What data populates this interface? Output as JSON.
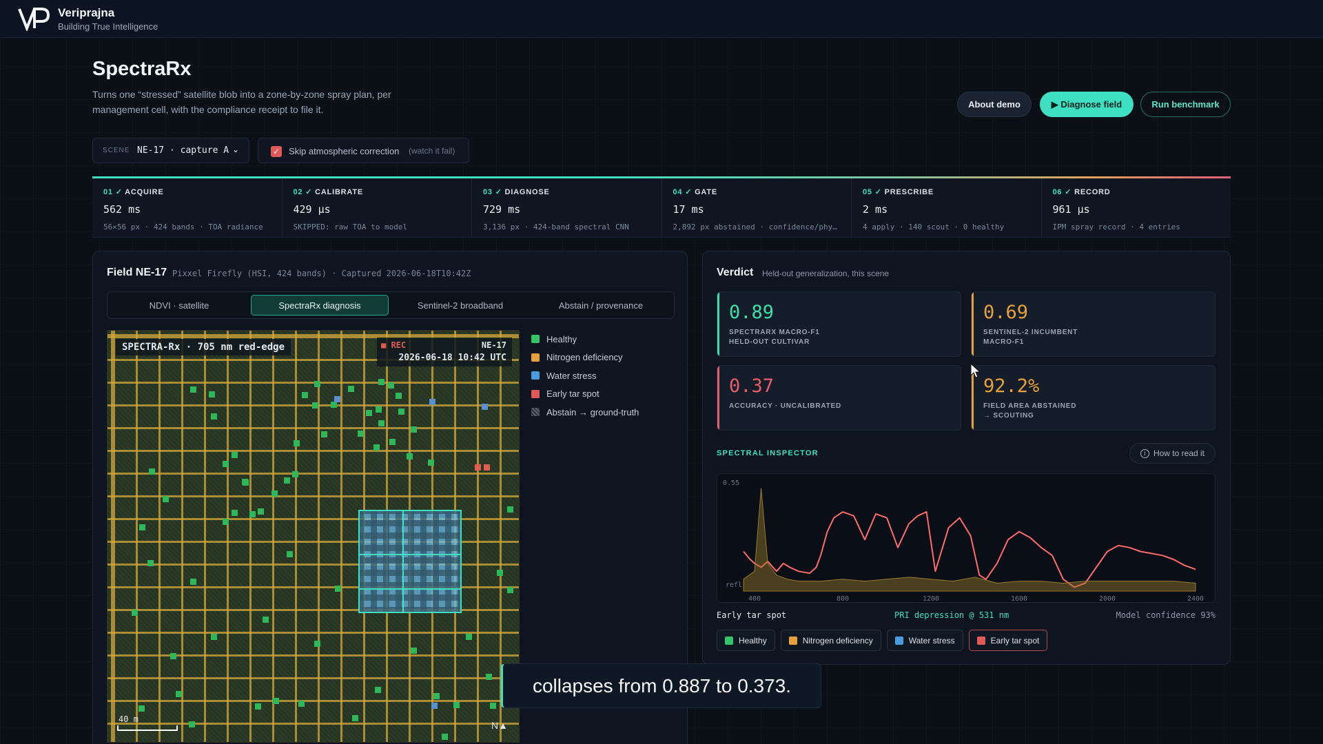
{
  "brand": {
    "name": "Veriprajna",
    "tagline": "Building True Intelligence"
  },
  "page": {
    "title": "SpectraRx",
    "subtitle": "Turns one “stressed” satellite blob into a zone-by-zone spray plan, per management cell, with the compliance receipt to file it."
  },
  "actions": {
    "about": "About demo",
    "diagnose": "▶ Diagnose field",
    "benchmark": "Run benchmark"
  },
  "scene": {
    "label": "SCENE",
    "value": "NE-17 · capture A",
    "chevron": "⌄"
  },
  "skip": {
    "label": "Skip atmospheric correction",
    "hint": "(watch it fail)",
    "checked": true
  },
  "pipeline": [
    {
      "num": "01",
      "name": "ACQUIRE",
      "value": "562 ms",
      "detail": "56×56 px · 424 bands · TOA radiance"
    },
    {
      "num": "02",
      "name": "CALIBRATE",
      "value": "429 µs",
      "detail": "SKIPPED: raw TOA to model"
    },
    {
      "num": "03",
      "name": "DIAGNOSE",
      "value": "729 ms",
      "detail": "3,136 px · 424-band spectral CNN"
    },
    {
      "num": "04",
      "name": "GATE",
      "value": "17 ms",
      "detail": "2,892 px abstained · confidence/phy…"
    },
    {
      "num": "05",
      "name": "PRESCRIBE",
      "value": "2 ms",
      "detail": "4 apply · 140 scout · 0 healthy"
    },
    {
      "num": "06",
      "name": "RECORD",
      "value": "961 µs",
      "detail": "IPM spray record · 4 entries"
    }
  ],
  "field": {
    "title": "Field NE-17",
    "meta": "Pixxel Firefly (HSI, 424 bands) · Captured 2026-06-18T10:42Z",
    "tabs": [
      "NDVI · satellite",
      "SpectraRx diagnosis",
      "Sentinel-2 broadband",
      "Abstain / provenance"
    ],
    "active_tab": 1,
    "map": {
      "label": "SPECTRA-Rx · 705 nm red-edge",
      "rec": "■ REC",
      "id": "NE-17",
      "timestamp": "2026-06-18 10:42 UTC",
      "scale": "40 m",
      "north": "N▲"
    },
    "legend": [
      {
        "label": "Healthy",
        "color": "#34c46a"
      },
      {
        "label": "Nitrogen deficiency",
        "color": "#e6a13a"
      },
      {
        "label": "Water stress",
        "color": "#4a9be0"
      },
      {
        "label": "Early tar spot",
        "color": "#e05a5a"
      },
      {
        "label": "Abstain → ground-truth",
        "color": "#5b6470"
      }
    ]
  },
  "verdict": {
    "title": "Verdict",
    "subtitle": "Held-out generalization, this scene",
    "cards": [
      {
        "value": "0.89",
        "label1": "SPECTRARX MACRO-F1",
        "label2": "HELD-OUT CULTIVAR",
        "color": "#3ee0a8"
      },
      {
        "value": "0.69",
        "label1": "SENTINEL-2 INCUMBENT",
        "label2": "MACRO-F1",
        "color": "#e6a13a"
      },
      {
        "value": "0.37",
        "label1": "ACCURACY · UNCALIBRATED",
        "label2": "",
        "color": "#e85d6a"
      },
      {
        "value": "92.2%",
        "label1": "FIELD AREA ABSTAINED",
        "label2": "→ SCOUTING",
        "color": "#e6a13a"
      }
    ]
  },
  "inspector": {
    "title": "SPECTRAL INSPECTOR",
    "howto": "How to read it",
    "class": "Early tar spot",
    "feature": "PRI depression @ 531 nm",
    "confidence": "Model confidence 93%",
    "chips": [
      {
        "label": "Healthy",
        "color": "#34c46a"
      },
      {
        "label": "Nitrogen deficiency",
        "color": "#e6a13a"
      },
      {
        "label": "Water stress",
        "color": "#4a9be0"
      },
      {
        "label": "Early tar spot",
        "color": "#e05a5a"
      }
    ],
    "selected_chip": 3
  },
  "chart_data": {
    "type": "line",
    "title": "",
    "xlabel": "",
    "ylabel": "refl",
    "xlim": [
      350,
      2450
    ],
    "ylim": [
      0,
      0.55
    ],
    "x_ticks": [
      "400",
      "800",
      "1200",
      "1600",
      "2000",
      "2400"
    ],
    "y_ticks": [
      "0.55"
    ],
    "series": [
      {
        "color": "#ff6b6b",
        "x": [
          350,
          380,
          400,
          430,
          460,
          500,
          531,
          560,
          600,
          650,
          680,
          700,
          730,
          760,
          800,
          850,
          900,
          950,
          1000,
          1050,
          1100,
          1140,
          1180,
          1220,
          1280,
          1330,
          1380,
          1420,
          1450,
          1500,
          1550,
          1600,
          1650,
          1700,
          1750,
          1800,
          1850,
          1900,
          1950,
          2000,
          2050,
          2100,
          2150,
          2200,
          2250,
          2300,
          2350,
          2400
        ],
        "y": [
          0.2,
          0.16,
          0.14,
          0.12,
          0.15,
          0.1,
          0.14,
          0.12,
          0.1,
          0.09,
          0.12,
          0.18,
          0.3,
          0.37,
          0.4,
          0.38,
          0.26,
          0.39,
          0.37,
          0.22,
          0.34,
          0.38,
          0.4,
          0.1,
          0.32,
          0.37,
          0.28,
          0.08,
          0.06,
          0.14,
          0.26,
          0.3,
          0.27,
          0.22,
          0.18,
          0.06,
          0.02,
          0.04,
          0.12,
          0.2,
          0.23,
          0.22,
          0.2,
          0.19,
          0.18,
          0.16,
          0.13,
          0.11
        ]
      },
      {
        "color": "#9a7a2a",
        "x": [
          350,
          400,
          430,
          460,
          500,
          550,
          600,
          700,
          800,
          900,
          1000,
          1100,
          1200,
          1300,
          1400,
          1500,
          1600,
          1700,
          1800,
          1900,
          2000,
          2100,
          2200,
          2300,
          2400
        ],
        "y": [
          0.06,
          0.1,
          0.52,
          0.14,
          0.08,
          0.06,
          0.05,
          0.05,
          0.06,
          0.05,
          0.06,
          0.07,
          0.06,
          0.05,
          0.07,
          0.04,
          0.05,
          0.05,
          0.04,
          0.05,
          0.05,
          0.05,
          0.05,
          0.05,
          0.04
        ]
      }
    ]
  },
  "caption": "collapses from 0.887 to 0.373."
}
